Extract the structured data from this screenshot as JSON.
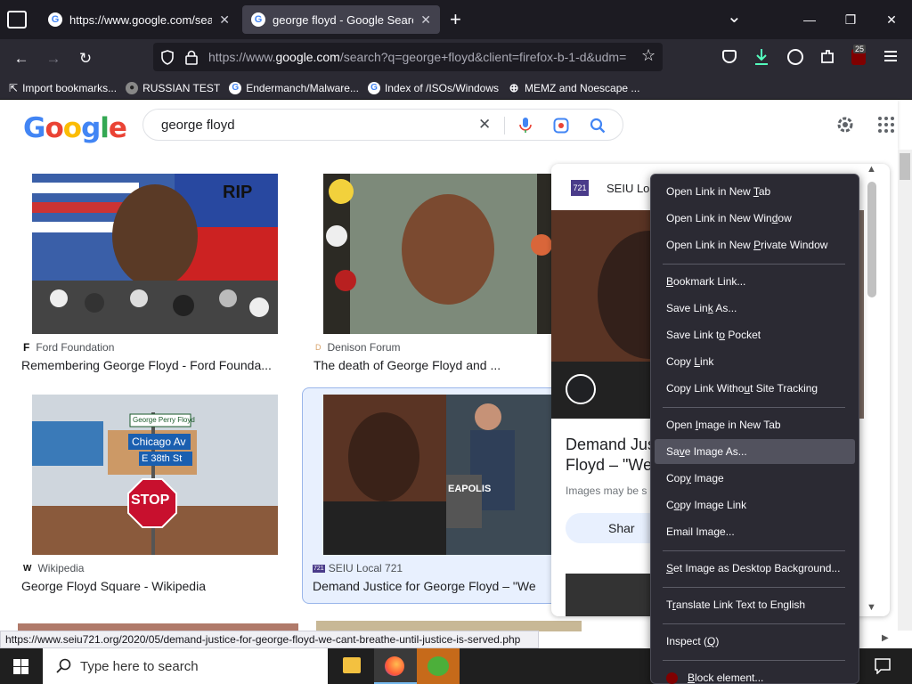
{
  "tabs": [
    {
      "title": "https://www.google.com/search?",
      "favicon": "G"
    },
    {
      "title": "george floyd - Google Search",
      "favicon": "G"
    }
  ],
  "icons": {
    "tab_list": "tab-list-icon",
    "new_tab": "+",
    "list_all": "⌄",
    "minimize": "—",
    "maximize": "❐",
    "close": "✕",
    "back": "←",
    "forward": "→",
    "reload": "↻",
    "pocket_badge": "25"
  },
  "url": {
    "host": "https://www.",
    "domain": "google.com",
    "rest": "/search?q=george+floyd&client=firefox-b-1-d&udm="
  },
  "bookmarks": [
    {
      "label": "Import bookmarks...",
      "icon": "import-icon"
    },
    {
      "label": "RUSSIAN TEST",
      "icon": "site-icon"
    },
    {
      "label": "Endermanch/Malware...",
      "icon": "G"
    },
    {
      "label": "Index of /ISOs/Windows",
      "icon": "G"
    },
    {
      "label": "MEMZ and Noescape ...",
      "icon": "globe-icon"
    }
  ],
  "google": {
    "logo": [
      {
        "c": "G",
        "color": "#4285f4"
      },
      {
        "c": "o",
        "color": "#ea4335"
      },
      {
        "c": "o",
        "color": "#fbbc05"
      },
      {
        "c": "g",
        "color": "#4285f4"
      },
      {
        "c": "l",
        "color": "#34a853"
      },
      {
        "c": "e",
        "color": "#ea4335"
      }
    ],
    "query": "george floyd"
  },
  "results": [
    {
      "source": "Ford Foundation",
      "title": "Remembering George Floyd - Ford Founda...",
      "badge": "F"
    },
    {
      "source": "Denison Forum",
      "title": "The death of George Floyd and ...",
      "badge": "D"
    },
    {
      "source": "Wikipedia",
      "title": "George Floyd Square - Wikipedia",
      "badge": "W"
    },
    {
      "source": "SEIU Local 721",
      "title": "Demand Justice for George Floyd – \"We",
      "badge": "721"
    }
  ],
  "thumb_text": {
    "rip": "RIP",
    "street1": "George Perry Floyd",
    "street2": "Chicago Av",
    "street3": "E 38th St",
    "stop": "STOP",
    "police": "EAPOLIS"
  },
  "preview": {
    "badge": "721",
    "source": "SEIU Lo",
    "title_line1": "Demand Jus",
    "title_line2": "Floyd – \"We",
    "subtitle": "Images may be s",
    "share": "Shar"
  },
  "context_menu": [
    {
      "label": "Open Link in New Tab",
      "key": "T"
    },
    {
      "label": "Open Link in New Window",
      "key": "d"
    },
    {
      "label": "Open Link in New Private Window",
      "key": "P"
    },
    {
      "sep": true
    },
    {
      "label": "Bookmark Link...",
      "key": "B"
    },
    {
      "label": "Save Link As...",
      "key": "k"
    },
    {
      "label": "Save Link to Pocket",
      "key": "o"
    },
    {
      "label": "Copy Link",
      "key": "L"
    },
    {
      "label": "Copy Link Without Site Tracking",
      "key": "u"
    },
    {
      "sep": true
    },
    {
      "label": "Open Image in New Tab",
      "key": "I"
    },
    {
      "label": "Save Image As...",
      "key": "v",
      "highlight": true
    },
    {
      "label": "Copy Image",
      "key": "y"
    },
    {
      "label": "Copy Image Link",
      "key": "o"
    },
    {
      "label": "Email Image...",
      "key": "g"
    },
    {
      "sep": true
    },
    {
      "label": "Set Image as Desktop Background...",
      "key": "S"
    },
    {
      "sep": true
    },
    {
      "label": "Translate Link Text to English",
      "key": "r"
    },
    {
      "sep": true
    },
    {
      "label": "Inspect (Q)",
      "key": "Q"
    },
    {
      "sep": true
    },
    {
      "label": "Block element...",
      "key": "B",
      "icon": true
    }
  ],
  "status_url": "https://www.seiu721.org/2020/05/demand-justice-for-george-floyd-we-cant-breathe-until-justice-is-served.php",
  "taskbar": {
    "search_placeholder": "Type here to search",
    "start_icon": "windows-icon"
  },
  "colors": {
    "tab_bg": "#1c1b22",
    "toolbar": "#2b2a33",
    "menu": "#2b2a33",
    "menu_hl": "#52525e",
    "google_blue": "#4285f4",
    "link": "#202124"
  }
}
